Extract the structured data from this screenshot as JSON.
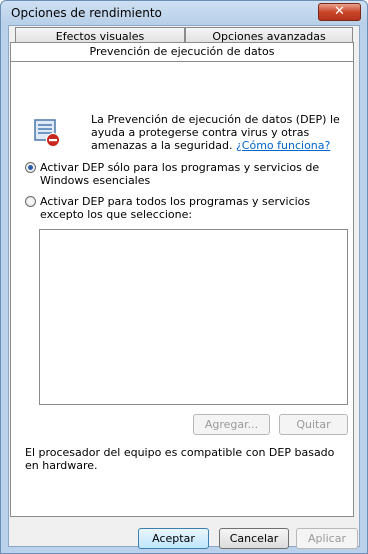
{
  "window": {
    "title": "Opciones de rendimiento",
    "close_glyph": "✕"
  },
  "tabs": [
    {
      "label": "Efectos visuales"
    },
    {
      "label": "Opciones avanzadas"
    },
    {
      "label": "Prevención de ejecución de datos"
    }
  ],
  "dep": {
    "icon": "dep-shield-icon",
    "description": "La Prevención de ejecución de datos (DEP) le ayuda a protegerse contra virus y otras amenazas a la seguridad.",
    "link": "¿Cómo funciona?",
    "options": [
      {
        "label": "Activar DEP sólo para los programas y servicios de Windows esenciales",
        "checked": true
      },
      {
        "label": "Activar DEP para todos los programas y servicios excepto los que seleccione:",
        "checked": false
      }
    ],
    "add_button": "Agregar...",
    "remove_button": "Quitar",
    "hardware_note": "El procesador del equipo es compatible con DEP basado en hardware."
  },
  "footer": {
    "ok": "Aceptar",
    "cancel": "Cancelar",
    "apply": "Aplicar"
  }
}
